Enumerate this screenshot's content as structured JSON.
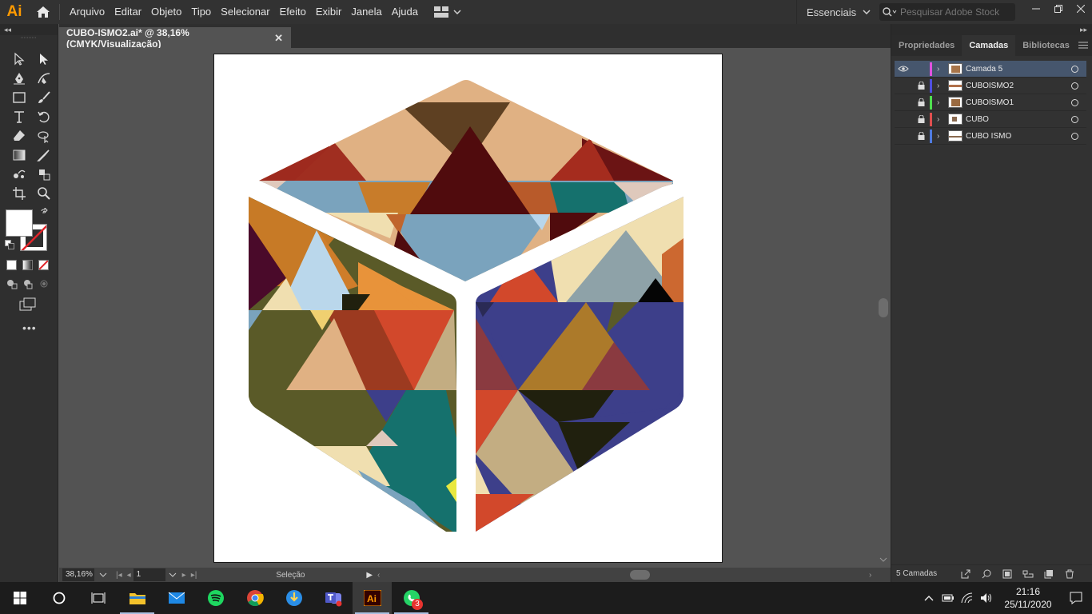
{
  "app": {
    "logo": "Ai",
    "menu": [
      "Arquivo",
      "Editar",
      "Objeto",
      "Tipo",
      "Selecionar",
      "Efeito",
      "Exibir",
      "Janela",
      "Ajuda"
    ],
    "workspace": "Essenciais",
    "stock_search_placeholder": "Pesquisar Adobe Stock"
  },
  "toolbar": {
    "collapse": "◂◂",
    "tools": [
      "selection-tool-icon",
      "direct-selection-tool-icon",
      "pen-tool-icon",
      "curvature-tool-icon",
      "rectangle-tool-icon",
      "paintbrush-tool-icon",
      "type-tool-icon",
      "rotate-tool-icon",
      "eraser-tool-icon",
      "free-transform-tool-icon",
      "gradient-tool-icon",
      "eyedropper-tool-icon",
      "blend-tool-icon",
      "symbol-sprayer-tool-icon",
      "artboard-tool-icon",
      "zoom-tool-icon"
    ],
    "more": "•••"
  },
  "document": {
    "tab_title": "CUBO-ISMO2.ai* @ 38,16% (CMYK/Visualização)",
    "close": "✕"
  },
  "statusbar": {
    "zoom": "38,16%",
    "artboard": "1",
    "status": "Seleção"
  },
  "panel": {
    "collapse": "▸▸",
    "tabs": [
      "Propriedades",
      "Camadas",
      "Bibliotecas"
    ],
    "active_tab": "Camadas",
    "layers": [
      {
        "name": "Camada 5",
        "visible": true,
        "locked": false,
        "color": "#e052e0",
        "selected": true
      },
      {
        "name": "CUBOISMO2",
        "visible": false,
        "locked": true,
        "color": "#4f4fe0",
        "selected": false
      },
      {
        "name": "CUBOISMO1",
        "visible": false,
        "locked": true,
        "color": "#4fe04f",
        "selected": false
      },
      {
        "name": "CUBO",
        "visible": false,
        "locked": true,
        "color": "#e04f4f",
        "selected": false
      },
      {
        "name": "CUBO ISMO",
        "visible": false,
        "locked": true,
        "color": "#4f7be0",
        "selected": false
      }
    ],
    "layer_count": "5 Camadas"
  },
  "taskbar": {
    "apps": [
      "file-explorer",
      "mail",
      "spotify",
      "chrome",
      "qbittorrent",
      "teams",
      "illustrator",
      "whatsapp"
    ],
    "active_app": "illustrator",
    "whatsapp_badge": "3",
    "time": "21:16",
    "date": "25/11/2020"
  },
  "colors": {
    "accent_ai": "#ff9a00",
    "panel_selected": "#46566d",
    "ui_dark": "#323232",
    "canvas_gray": "#535353"
  }
}
